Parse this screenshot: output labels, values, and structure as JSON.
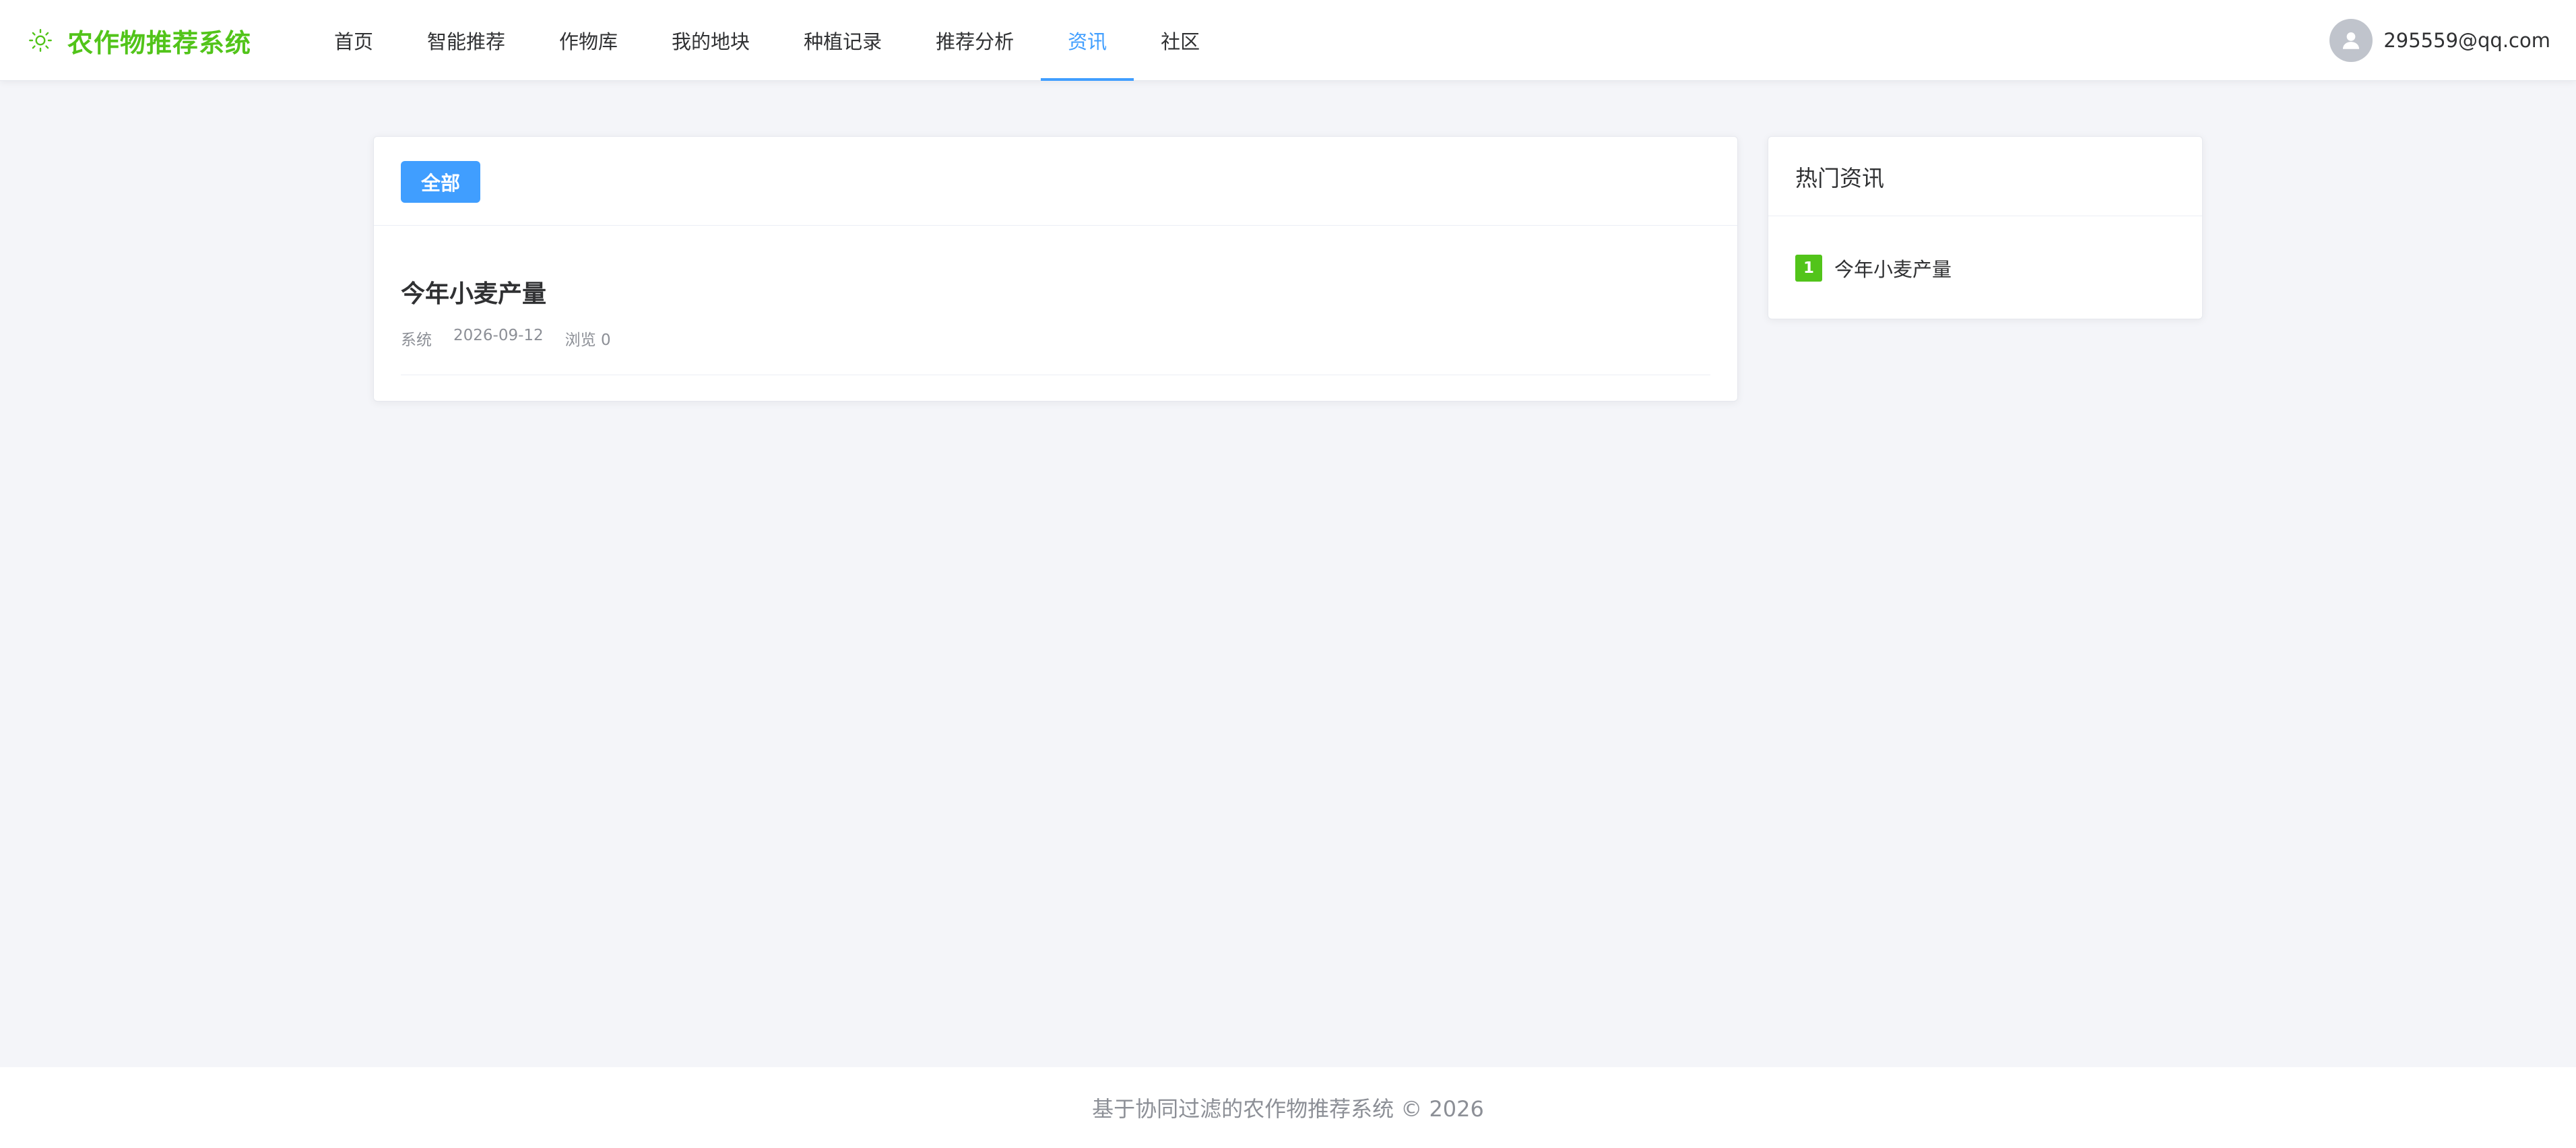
{
  "app": {
    "title": "农作物推荐系统",
    "logo_icon": "sun-icon",
    "brand_color": "#52c41a"
  },
  "nav": {
    "items": [
      {
        "label": "首页"
      },
      {
        "label": "智能推荐"
      },
      {
        "label": "作物库"
      },
      {
        "label": "我的地块"
      },
      {
        "label": "种植记录"
      },
      {
        "label": "推荐分析"
      },
      {
        "label": "资讯",
        "active": true
      },
      {
        "label": "社区"
      }
    ],
    "active_color": "#409eff"
  },
  "user": {
    "email": "295559@qq.com",
    "avatar_icon": "user-avatar-icon"
  },
  "filter": {
    "all_label": "全部"
  },
  "articles": [
    {
      "title": "今年小麦产量",
      "author": "系统",
      "date": "2026-09-12",
      "views": "浏览 0"
    }
  ],
  "hot_news": {
    "title": "热门资讯",
    "items": [
      {
        "rank": "1",
        "title": "今年小麦产量"
      }
    ]
  },
  "footer": {
    "text": "基于协同过滤的农作物推荐系统 © 2026"
  }
}
